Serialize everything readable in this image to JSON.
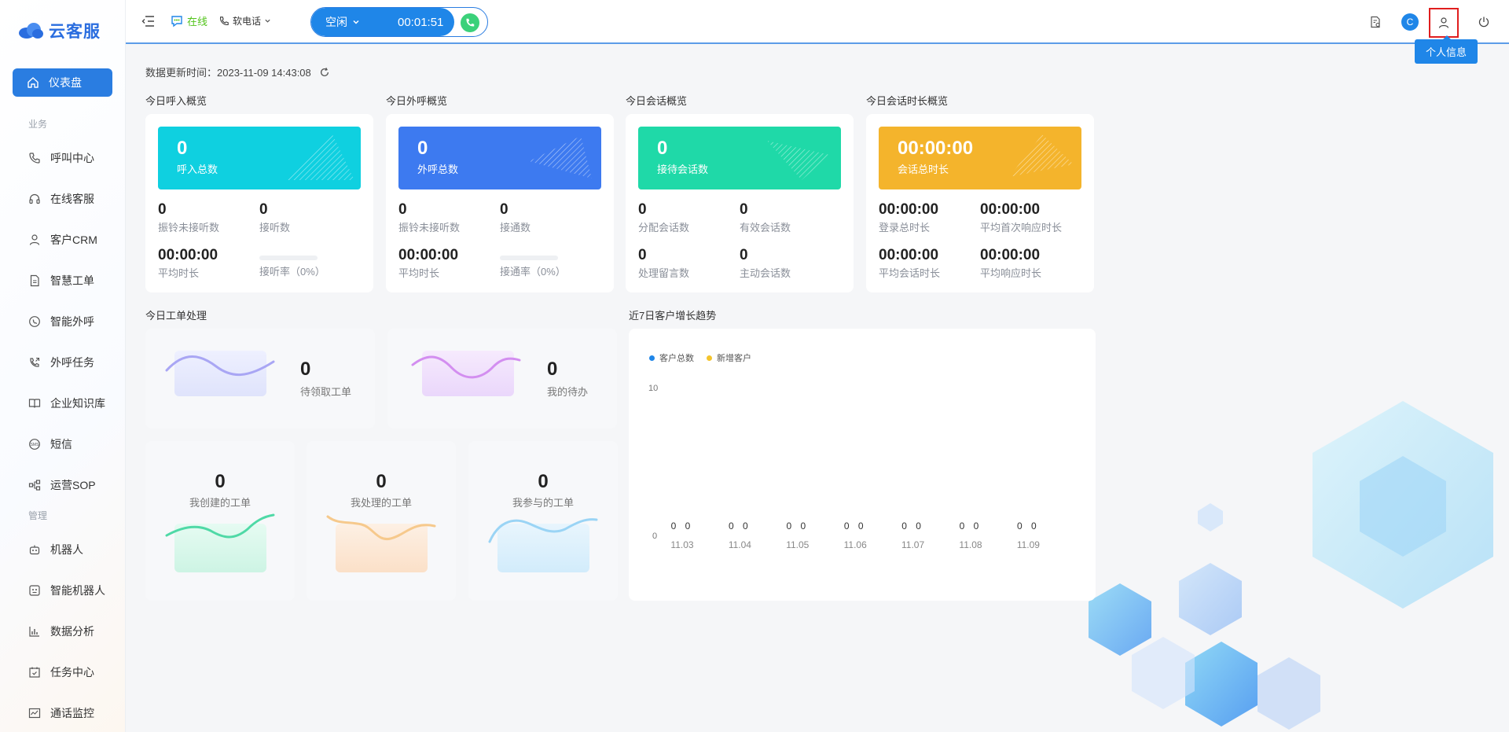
{
  "app": {
    "name": "云客服"
  },
  "sidebar": {
    "active": "仪表盘",
    "sections": [
      {
        "title": "业务",
        "items": [
          "呼叫中心",
          "在线客服",
          "客户CRM",
          "智慧工单",
          "智能外呼",
          "外呼任务",
          "企业知识库",
          "短信",
          "运营SOP"
        ]
      },
      {
        "title": "管理",
        "items": [
          "机器人",
          "智能机器人",
          "数据分析",
          "任务中心",
          "通话监控"
        ]
      }
    ]
  },
  "topbar": {
    "status": "在线",
    "phone_type": "软电话",
    "call_state": "空闲",
    "call_timer": "00:01:51",
    "avatar_letter": "C",
    "tooltip": "个人信息"
  },
  "update": {
    "label": "数据更新时间：",
    "time": "2023-11-09 14:43:08"
  },
  "overview": [
    {
      "title": "今日呼入概览",
      "banner_value": "0",
      "banner_label": "呼入总数",
      "color": "#0fd0e0",
      "m1v": "0",
      "m1l": "振铃未接听数",
      "m2v": "0",
      "m2l": "接听数",
      "m3v": "00:00:00",
      "m3l": "平均时长",
      "m4l": "接听率（0%）"
    },
    {
      "title": "今日外呼概览",
      "banner_value": "0",
      "banner_label": "外呼总数",
      "color": "#3d7af0",
      "m1v": "0",
      "m1l": "振铃未接听数",
      "m2v": "0",
      "m2l": "接通数",
      "m3v": "00:00:00",
      "m3l": "平均时长",
      "m4l": "接通率（0%）"
    },
    {
      "title": "今日会话概览",
      "banner_value": "0",
      "banner_label": "接待会话数",
      "color": "#1fd9a8",
      "m1v": "0",
      "m1l": "分配会话数",
      "m2v": "0",
      "m2l": "有效会话数",
      "m3v": "0",
      "m3l": "处理留言数",
      "m4v": "0",
      "m4l": "主动会话数"
    },
    {
      "title": "今日会话时长概览",
      "banner_value": "00:00:00",
      "banner_label": "会话总时长",
      "color": "#f4b42c",
      "m1v": "00:00:00",
      "m1l": "登录总时长",
      "m2v": "00:00:00",
      "m2l": "平均首次响应时长",
      "m3v": "00:00:00",
      "m3l": "平均会话时长",
      "m4v": "00:00:00",
      "m4l": "平均响应时长"
    }
  ],
  "workorders": {
    "title": "今日工单处理",
    "items": [
      {
        "value": "0",
        "label": "待领取工单"
      },
      {
        "value": "0",
        "label": "我的待办"
      },
      {
        "value": "0",
        "label": "我创建的工单"
      },
      {
        "value": "0",
        "label": "我处理的工单"
      },
      {
        "value": "0",
        "label": "我参与的工单"
      }
    ]
  },
  "trend": {
    "title": "近7日客户增长趋势",
    "y_max_label": "10",
    "y_min_label": "0",
    "data_label_zero": "0 0"
  },
  "chart_data": {
    "type": "bar",
    "categories": [
      "11.03",
      "11.04",
      "11.05",
      "11.06",
      "11.07",
      "11.08",
      "11.09"
    ],
    "series": [
      {
        "name": "客户总数",
        "color": "#1f86e8",
        "values": [
          0,
          0,
          0,
          0,
          0,
          0,
          0
        ]
      },
      {
        "name": "新增客户",
        "color": "#f4c42c",
        "values": [
          0,
          0,
          0,
          0,
          0,
          0,
          0
        ]
      }
    ],
    "ylim": [
      0,
      10
    ],
    "legend": "top-left",
    "grid": false
  }
}
